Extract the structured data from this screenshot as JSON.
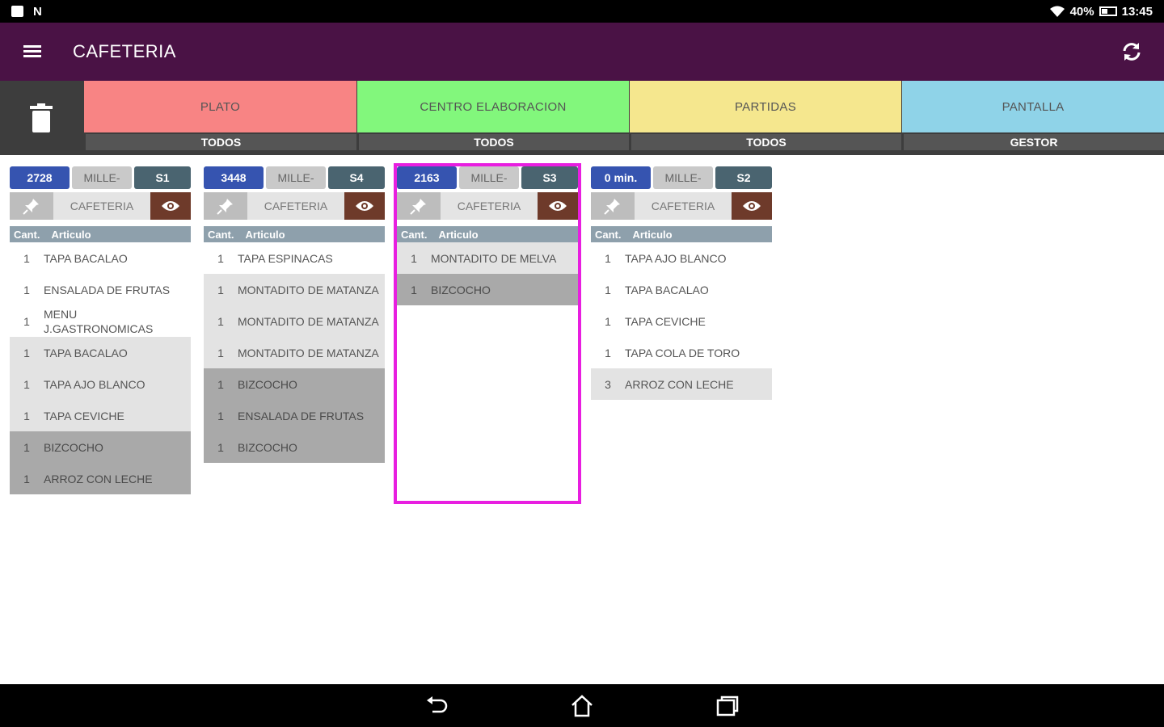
{
  "status": {
    "battery": "40%",
    "time": "13:45",
    "notif_n": "N"
  },
  "appbar": {
    "title": "CAFETERIA"
  },
  "filters": [
    {
      "label": "PLATO",
      "value": "TODOS",
      "color": "#f88484"
    },
    {
      "label": "CENTRO ELABORACION",
      "value": "TODOS",
      "color": "#82f77c"
    },
    {
      "label": "PARTIDAS",
      "value": "TODOS",
      "color": "#f5e78e"
    },
    {
      "label": "PANTALLA",
      "value": "GESTOR",
      "color": "#8fd3e8"
    }
  ],
  "columns": {
    "qty": "Cant.",
    "article": "Articulo"
  },
  "tickets": [
    {
      "number": "2728",
      "waiter": "MILLE-",
      "table": "S1",
      "station": "CAFETERIA",
      "items": [
        {
          "qty": "1",
          "article": "TAPA BACALAO",
          "state": 0
        },
        {
          "qty": "1",
          "article": "ENSALADA DE FRUTAS",
          "state": 0
        },
        {
          "qty": "1",
          "article": "MENU J.GASTRONOMICAS",
          "state": 0
        },
        {
          "qty": "1",
          "article": "TAPA BACALAO",
          "state": 1
        },
        {
          "qty": "1",
          "article": "TAPA AJO BLANCO",
          "state": 1
        },
        {
          "qty": "1",
          "article": "TAPA CEVICHE",
          "state": 1
        },
        {
          "qty": "1",
          "article": "BIZCOCHO",
          "state": 2
        },
        {
          "qty": "1",
          "article": "ARROZ CON LECHE",
          "state": 2
        }
      ]
    },
    {
      "number": "3448",
      "waiter": "MILLE-",
      "table": "S4",
      "station": "CAFETERIA",
      "items": [
        {
          "qty": "1",
          "article": "TAPA ESPINACAS",
          "state": 0
        },
        {
          "qty": "1",
          "article": "MONTADITO DE MATANZA",
          "state": 1
        },
        {
          "qty": "1",
          "article": "MONTADITO DE MATANZA",
          "state": 1
        },
        {
          "qty": "1",
          "article": "MONTADITO DE MATANZA",
          "state": 1
        },
        {
          "qty": "1",
          "article": "BIZCOCHO",
          "state": 2
        },
        {
          "qty": "1",
          "article": "ENSALADA DE FRUTAS",
          "state": 2
        },
        {
          "qty": "1",
          "article": "BIZCOCHO",
          "state": 2
        }
      ]
    },
    {
      "number": "2163",
      "waiter": "MILLE-",
      "table": "S3",
      "station": "CAFETERIA",
      "items": [
        {
          "qty": "1",
          "article": "MONTADITO DE MELVA",
          "state": 1
        },
        {
          "qty": "1",
          "article": "BIZCOCHO",
          "state": 2
        }
      ]
    },
    {
      "number": "0 min.",
      "waiter": "MILLE-",
      "table": "S2",
      "station": "CAFETERIA",
      "items": [
        {
          "qty": "1",
          "article": "TAPA AJO BLANCO",
          "state": 0
        },
        {
          "qty": "1",
          "article": "TAPA BACALAO",
          "state": 0
        },
        {
          "qty": "1",
          "article": "TAPA CEVICHE",
          "state": 0
        },
        {
          "qty": "1",
          "article": "TAPA COLA DE TORO",
          "state": 0
        },
        {
          "qty": "3",
          "article": "ARROZ CON LECHE",
          "state": 1
        }
      ]
    }
  ],
  "colors": {
    "appbar": "#4a1245",
    "selected": "#e81ee0",
    "ticket_number": "#3654b0",
    "eye_button": "#6e3a2a"
  }
}
